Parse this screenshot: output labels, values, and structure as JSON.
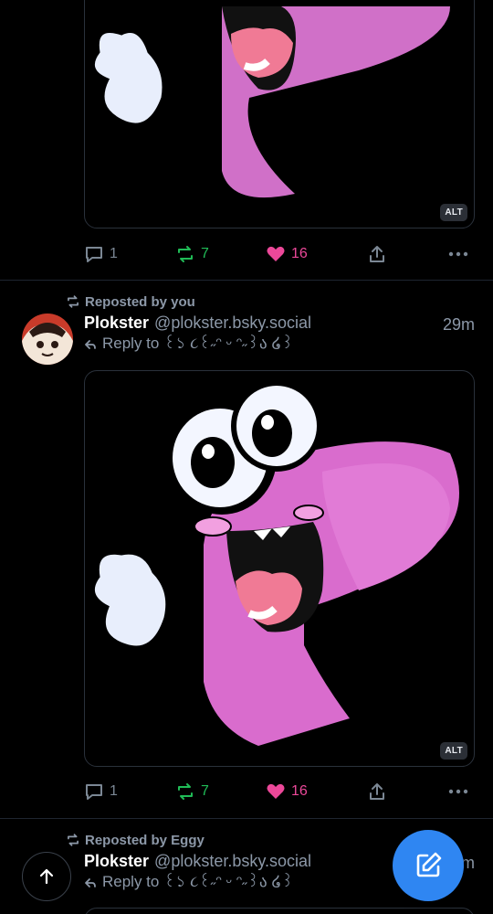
{
  "colors": {
    "background": "#000000",
    "accent": "#2f86f2",
    "repost": "#20bc57",
    "like": "#ec4899",
    "muted": "#8c98a8"
  },
  "posts": [
    {
      "image_alt_badge": "ALT",
      "actions": {
        "replies": "1",
        "reposts": "7",
        "likes": "16"
      }
    },
    {
      "reposted_by": "Reposted by you",
      "author": {
        "name": "Plokster",
        "handle": "@plokster.bsky.social"
      },
      "time": "29m",
      "reply_to": "Reply to ꒰১ ૮꒰˶ᵔ ᵕ ᵔ˶꒱ა ໒꒱",
      "image_alt_badge": "ALT",
      "actions": {
        "replies": "1",
        "reposts": "7",
        "likes": "16"
      }
    },
    {
      "reposted_by": "Reposted by Eggy",
      "author": {
        "name": "Plokster",
        "handle": "@plokster.bsky.social"
      },
      "time": "29m",
      "reply_to": "Reply to ꒰১ ૮꒰˶ᵔ ᵕ ᵔ˶꒱ა ໒꒱"
    }
  ],
  "icons": {
    "reply": "reply-icon",
    "repost": "repost-icon",
    "like": "heart-icon",
    "share": "share-icon",
    "more": "more-icon",
    "compose": "compose-icon",
    "scroll_top": "arrow-up-icon"
  }
}
